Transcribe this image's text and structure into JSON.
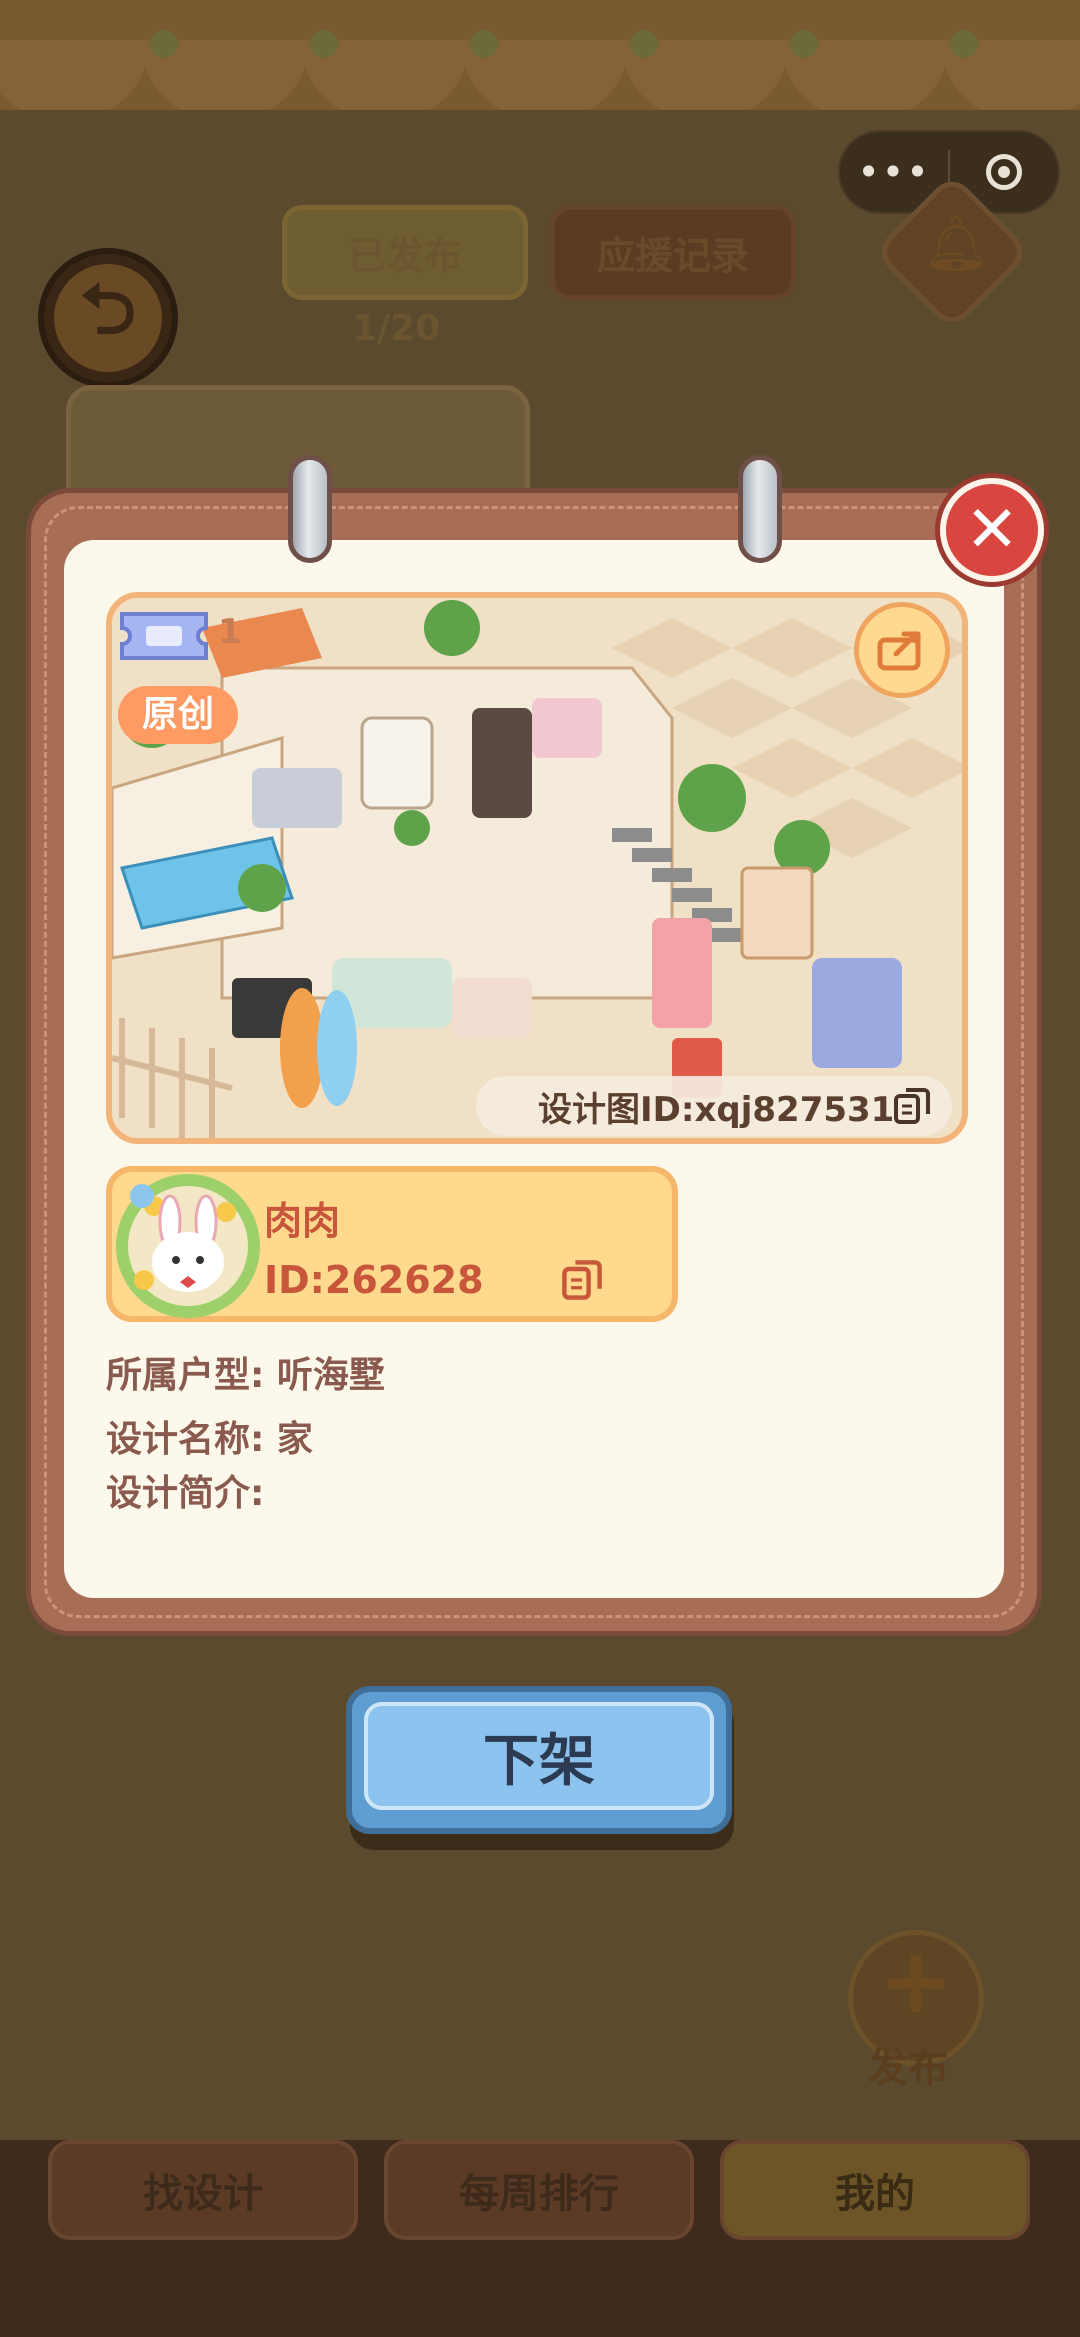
{
  "background": {
    "tabs": [
      {
        "label": "已发布",
        "active": true
      },
      {
        "label": "应援记录",
        "active": false
      }
    ],
    "count": "1/20",
    "fab_label": "发布",
    "bottom_nav": [
      {
        "label": "找设计",
        "active": false
      },
      {
        "label": "每周排行",
        "active": false
      },
      {
        "label": "我的",
        "active": true
      }
    ]
  },
  "capsule": {
    "more_icon": "more-dots-icon",
    "close_icon": "target-icon"
  },
  "modal": {
    "ticket_count": "1",
    "original_badge": "原创",
    "design_id": "设计图ID:xqj827531",
    "author": {
      "name": "肉肉",
      "id": "ID:262628"
    },
    "fields": {
      "house_type": "所属户型: 听海墅",
      "design_name": "设计名称: 家",
      "design_intro": "设计简介:"
    },
    "action_label": "下架"
  },
  "colors": {
    "close_button": "#d9453f",
    "action_button": "#5e9ed2",
    "author_card": "#ffd98e",
    "badge": "#ff9b62"
  }
}
